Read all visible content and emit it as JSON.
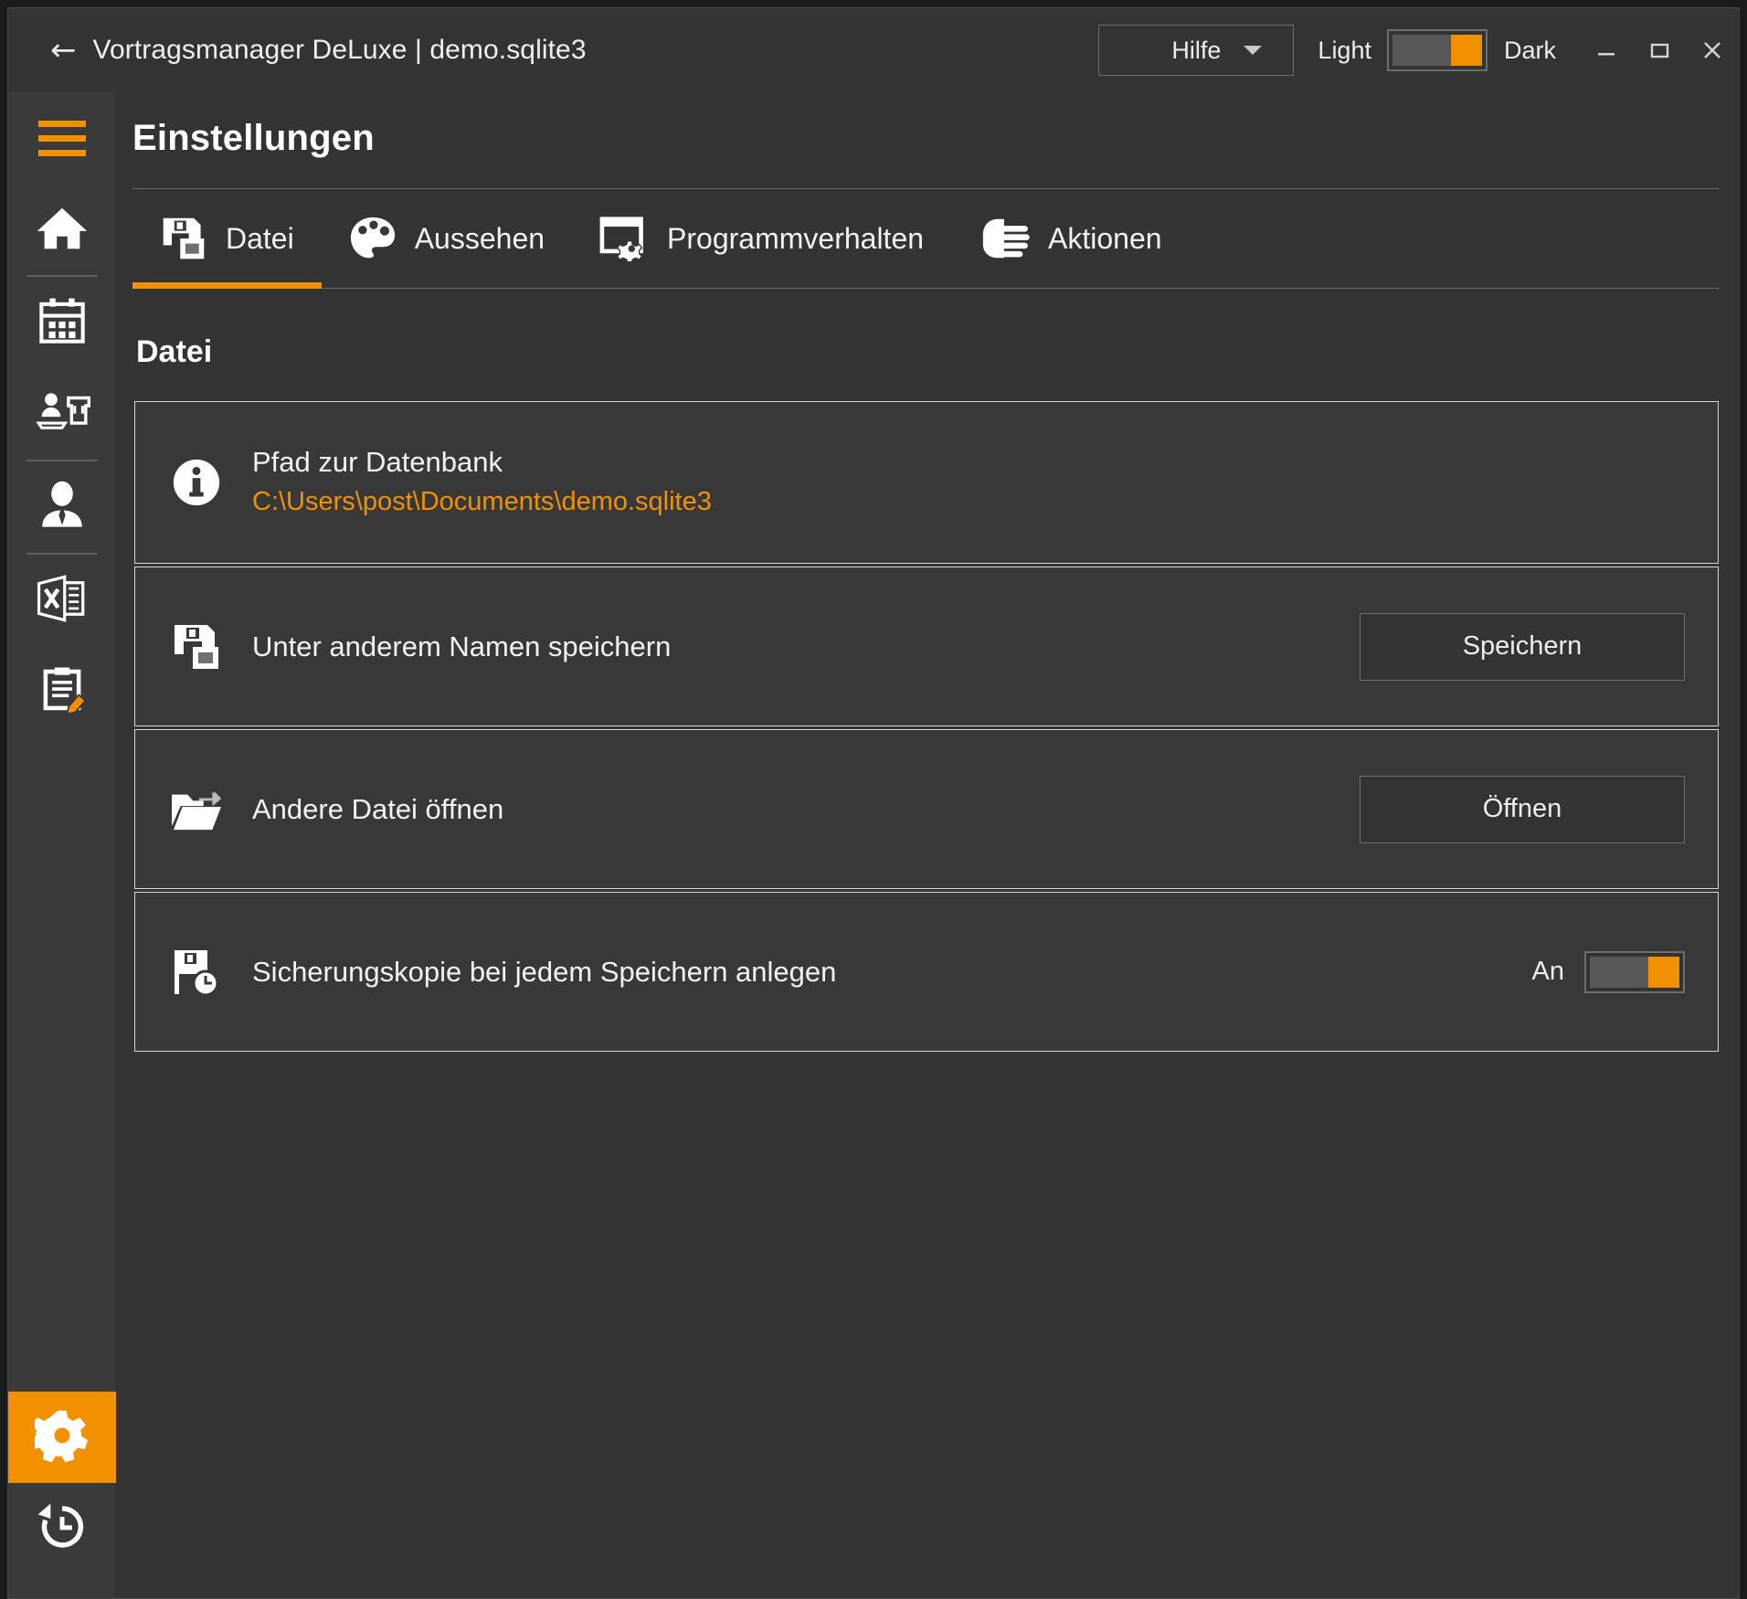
{
  "titlebar": {
    "back_icon": "arrow-left-icon",
    "title": "Vortragsmanager DeLuxe | demo.sqlite3",
    "help_label": "Hilfe",
    "theme_light_label": "Light",
    "theme_dark_label": "Dark",
    "theme_state": "dark",
    "minimize_label": "Minimieren",
    "maximize_label": "Maximieren",
    "close_label": "Schließen"
  },
  "sidebar": {
    "items": [
      {
        "name": "menu-toggle",
        "icon": "hamburger-icon",
        "active": false
      },
      {
        "name": "home",
        "icon": "home-icon",
        "active": false
      },
      {
        "name": "calendar",
        "icon": "calendar-icon",
        "active": false
      },
      {
        "name": "speaker-lectern",
        "icon": "person-lectern-icon",
        "active": false
      },
      {
        "name": "person",
        "icon": "person-suit-icon",
        "active": false
      },
      {
        "name": "excel-export",
        "icon": "excel-icon",
        "active": false
      },
      {
        "name": "notes",
        "icon": "clipboard-pencil-icon",
        "active": false
      },
      {
        "name": "settings",
        "icon": "gear-icon",
        "active": true
      },
      {
        "name": "history",
        "icon": "history-clock-icon",
        "active": false
      }
    ]
  },
  "page": {
    "title": "Einstellungen",
    "section_title": "Datei"
  },
  "tabs": [
    {
      "label": "Datei",
      "icon": "save-as-icon",
      "active": true
    },
    {
      "label": "Aussehen",
      "icon": "palette-icon",
      "active": false
    },
    {
      "label": "Programmverhalten",
      "icon": "window-gear-icon",
      "active": false
    },
    {
      "label": "Aktionen",
      "icon": "hand-pointing-icon",
      "active": false
    }
  ],
  "cards": [
    {
      "id": "db-path",
      "icon": "info-icon",
      "label": "Pfad zur Datenbank",
      "sub": "C:\\Users\\post\\Documents\\demo.sqlite3"
    },
    {
      "id": "save-as",
      "icon": "save-as-icon",
      "label": "Unter anderem Namen speichern",
      "button": "Speichern"
    },
    {
      "id": "open-other",
      "icon": "folder-open-icon",
      "label": "Andere Datei öffnen",
      "button": "Öffnen"
    },
    {
      "id": "backup-on-save",
      "icon": "save-clock-icon",
      "label": "Sicherungskopie bei jedem Speichern anlegen",
      "toggle_state": "An"
    }
  ],
  "colors": {
    "accent": "#f29100",
    "window_bg": "#333333",
    "sidebar_bg": "#3a3a3a",
    "card_bg": "#383838",
    "card_border": "#d6d6d6",
    "text": "#f2f2f2"
  }
}
